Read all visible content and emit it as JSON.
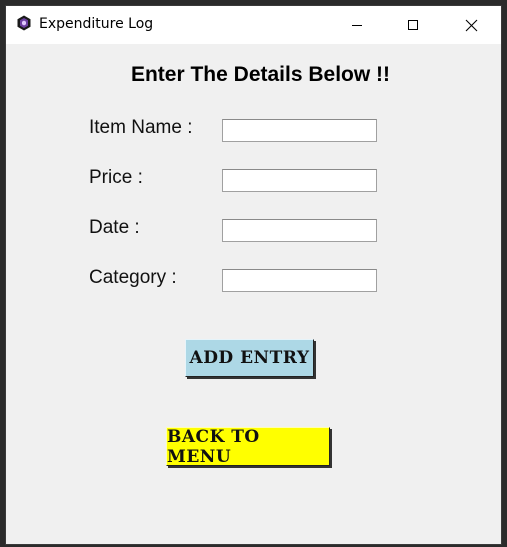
{
  "window": {
    "title": "Expenditure Log",
    "icon": "app-logo-icon"
  },
  "form": {
    "heading": "Enter The Details Below !!",
    "fields": [
      {
        "label": "Item Name :",
        "value": ""
      },
      {
        "label": "Price :",
        "value": ""
      },
      {
        "label": "Date :",
        "value": ""
      },
      {
        "label": "Category :",
        "value": ""
      }
    ]
  },
  "buttons": {
    "add_entry": "Add Entry",
    "back_to_menu": "Back to Menu"
  },
  "colors": {
    "add_entry_bg": "#add8e6",
    "back_to_menu_bg": "#ffff00",
    "window_bg": "#f0f0f0"
  }
}
